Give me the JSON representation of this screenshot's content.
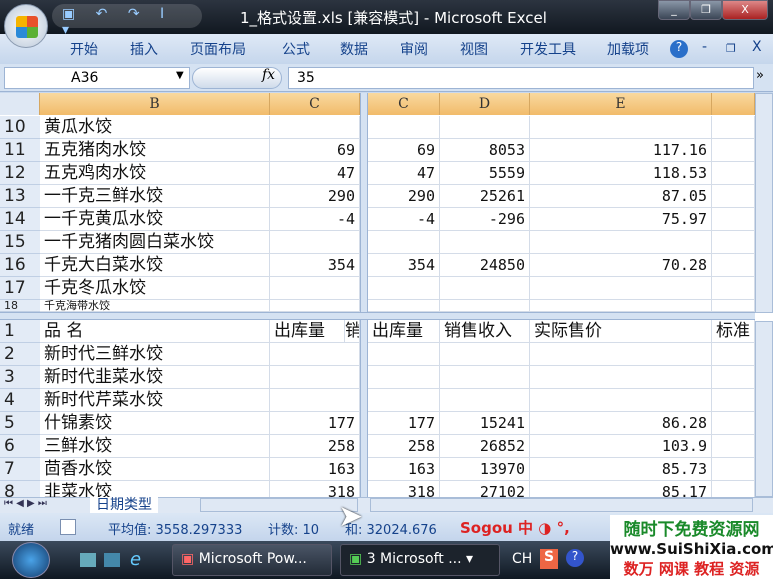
{
  "window": {
    "title": "1_格式设置.xls  [兼容模式] - Microsoft Excel",
    "minimize": "_",
    "restore": "❐",
    "close": "X"
  },
  "qat": "▣ ↶ ↷ I ▾",
  "ribbon": {
    "tabs": [
      "开始",
      "插入",
      "页面布局",
      "公式",
      "数据",
      "审阅",
      "视图",
      "开发工具",
      "加载项"
    ],
    "help": "?",
    "min": "-",
    "restore": "❐",
    "close": "X"
  },
  "formula_bar": {
    "name_box": "A36",
    "fx": "fx",
    "value": "35",
    "expand": "»"
  },
  "top_left": {
    "cols": [
      "B",
      "C"
    ],
    "rows": [
      {
        "n": "10",
        "b": "黄瓜水饺",
        "c": ""
      },
      {
        "n": "11",
        "b": "五克猪肉水饺",
        "c": "69"
      },
      {
        "n": "12",
        "b": "五克鸡肉水饺",
        "c": "47"
      },
      {
        "n": "13",
        "b": "一千克三鲜水饺",
        "c": "290"
      },
      {
        "n": "14",
        "b": "一千克黄瓜水饺",
        "c": "-4"
      },
      {
        "n": "15",
        "b": "一千克猪肉圆白菜水饺",
        "c": ""
      },
      {
        "n": "16",
        "b": "千克大白菜水饺",
        "c": "354"
      },
      {
        "n": "17",
        "b": "千克冬瓜水饺",
        "c": ""
      },
      {
        "n": "18",
        "b": "千克海带水饺",
        "c": ""
      }
    ]
  },
  "top_right": {
    "cols": [
      "C",
      "D",
      "E",
      ""
    ],
    "rows": [
      [
        "",
        "",
        ""
      ],
      [
        "69",
        "8053",
        "117.16"
      ],
      [
        "47",
        "5559",
        "118.53"
      ],
      [
        "290",
        "25261",
        "87.05"
      ],
      [
        "-4",
        "-296",
        "75.97"
      ],
      [
        "",
        "",
        ""
      ],
      [
        "354",
        "24850",
        "70.28"
      ],
      [
        "",
        "",
        ""
      ],
      [
        "",
        "",
        ""
      ]
    ]
  },
  "bottom_left": {
    "rows": [
      {
        "n": "1",
        "b": "品  名",
        "c": "出库量",
        "d": "销"
      },
      {
        "n": "2",
        "b": "新时代三鲜水饺",
        "c": ""
      },
      {
        "n": "3",
        "b": "新时代韭菜水饺",
        "c": ""
      },
      {
        "n": "4",
        "b": "新时代芹菜水饺",
        "c": ""
      },
      {
        "n": "5",
        "b": "什锦素饺",
        "c": "177"
      },
      {
        "n": "6",
        "b": "三鲜水饺",
        "c": "258"
      },
      {
        "n": "7",
        "b": "茴香水饺",
        "c": "163"
      },
      {
        "n": "8",
        "b": "韭菜水饺",
        "c": "318"
      }
    ]
  },
  "bottom_right": {
    "rows": [
      [
        "出库量",
        "销售收入",
        "实际售价",
        "标准"
      ],
      [
        "",
        "",
        "",
        ""
      ],
      [
        "",
        "",
        "",
        ""
      ],
      [
        "",
        "",
        "",
        ""
      ],
      [
        "177",
        "15241",
        "86.28",
        ""
      ],
      [
        "258",
        "26852",
        "103.9",
        ""
      ],
      [
        "163",
        "13970",
        "85.73",
        ""
      ],
      [
        "318",
        "27102",
        "85.17",
        ""
      ]
    ]
  },
  "sheet_tab": "日期类型",
  "status": {
    "ready": "就绪",
    "average": "平均值: 3558.297333",
    "count": "计数: 10",
    "sum": "和: 32024.676",
    "ime": "Sogou 中 ◑ °,"
  },
  "taskbar": {
    "items": [
      "Microsoft Pow...",
      "3 Microsoft ..."
    ],
    "lang": "CH"
  },
  "watermark": {
    "line1": "随时下免费资源网",
    "line2": "www.SuiShiXia.com",
    "line3": "数万 网课 教程 资源"
  }
}
